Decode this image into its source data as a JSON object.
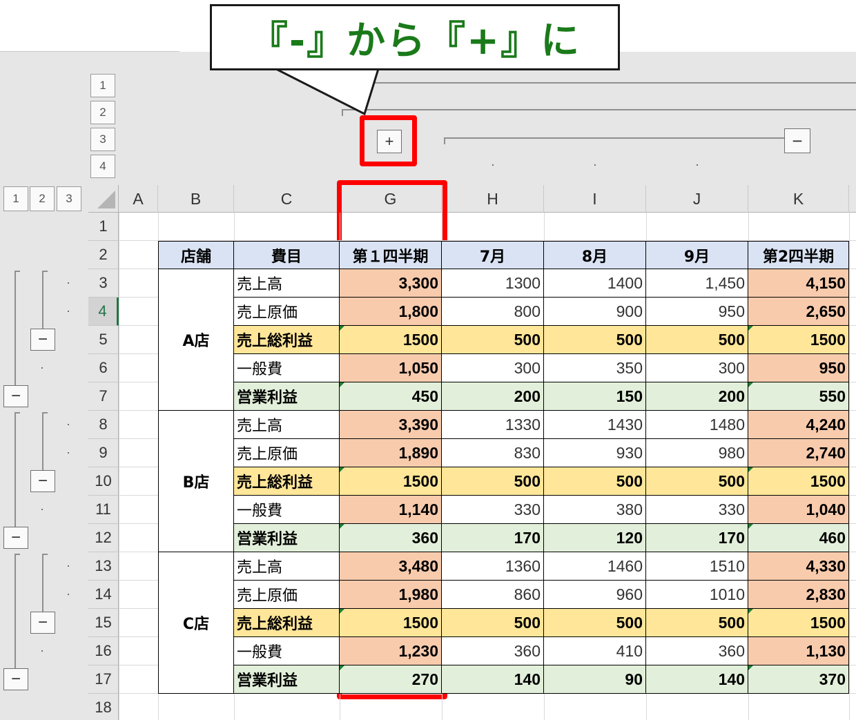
{
  "callout": {
    "text": "『-』から『+』に"
  },
  "outline": {
    "col_levels": [
      "1",
      "2",
      "3",
      "4"
    ],
    "row_levels": [
      "1",
      "2",
      "3"
    ],
    "plus_symbol": "+",
    "minus_symbol": "−"
  },
  "columns": [
    "A",
    "B",
    "C",
    "G",
    "H",
    "I",
    "J",
    "K"
  ],
  "rows": [
    "1",
    "2",
    "3",
    "4",
    "5",
    "6",
    "7",
    "8",
    "9",
    "10",
    "11",
    "12",
    "13",
    "14",
    "15",
    "16",
    "17",
    "18"
  ],
  "selected_row": "4",
  "table": {
    "headers": [
      "店舗",
      "費目",
      "第１四半期",
      "7月",
      "8月",
      "9月",
      "第2四半期"
    ],
    "stores": [
      "A店",
      "B店",
      "C店"
    ],
    "rows": [
      [
        "売上高",
        "3,300",
        "1300",
        "1400",
        "1,450",
        "4,150"
      ],
      [
        "売上原価",
        "1,800",
        "800",
        "900",
        "950",
        "2,650"
      ],
      [
        "売上総利益",
        "1500",
        "500",
        "500",
        "500",
        "1500"
      ],
      [
        "一般費",
        "1,050",
        "300",
        "350",
        "300",
        "950"
      ],
      [
        "営業利益",
        "450",
        "200",
        "150",
        "200",
        "550"
      ],
      [
        "売上高",
        "3,390",
        "1330",
        "1430",
        "1480",
        "4,240"
      ],
      [
        "売上原価",
        "1,890",
        "830",
        "930",
        "980",
        "2,740"
      ],
      [
        "売上総利益",
        "1500",
        "500",
        "500",
        "500",
        "1500"
      ],
      [
        "一般費",
        "1,140",
        "330",
        "380",
        "330",
        "1,040"
      ],
      [
        "営業利益",
        "360",
        "170",
        "120",
        "170",
        "460"
      ],
      [
        "売上高",
        "3,480",
        "1360",
        "1460",
        "1510",
        "4,330"
      ],
      [
        "売上原価",
        "1,980",
        "860",
        "960",
        "1010",
        "2,830"
      ],
      [
        "売上総利益",
        "1500",
        "500",
        "500",
        "500",
        "1500"
      ],
      [
        "一般費",
        "1,230",
        "360",
        "410",
        "360",
        "1,130"
      ],
      [
        "営業利益",
        "270",
        "140",
        "90",
        "140",
        "370"
      ]
    ]
  },
  "colors": {
    "header_bg": "#dae3f3",
    "salmon": "#f8cbad",
    "yellow": "#ffe699",
    "green": "#e2efda",
    "highlight": "#ff0000",
    "callout_text": "#1a7a1a"
  }
}
